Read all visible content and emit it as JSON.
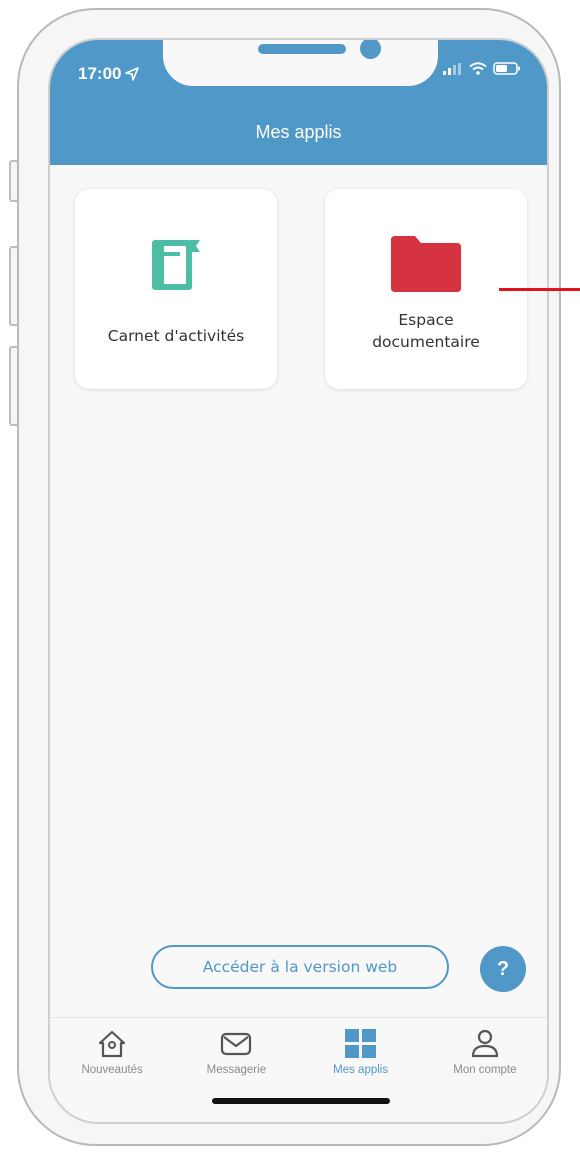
{
  "status_bar": {
    "time": "17:00",
    "icons": [
      "location-arrow-icon",
      "signal-icon",
      "wifi-icon",
      "battery-icon"
    ]
  },
  "header": {
    "title": "Mes applis"
  },
  "apps": [
    {
      "label": "Carnet d'activités",
      "icon": "notebook-icon",
      "color": "#4dbda6"
    },
    {
      "label": "Espace documentaire",
      "icon": "folder-icon",
      "color": "#d4333f"
    }
  ],
  "actions": {
    "web_version_label": "Accéder à la version web",
    "help_label": "?"
  },
  "tabbar": {
    "items": [
      {
        "label": "Nouveautés",
        "icon": "home-icon",
        "active": false
      },
      {
        "label": "Messagerie",
        "icon": "mail-icon",
        "active": false
      },
      {
        "label": "Mes applis",
        "icon": "apps-grid-icon",
        "active": true
      },
      {
        "label": "Mon compte",
        "icon": "user-icon",
        "active": false
      }
    ]
  },
  "colors": {
    "primary": "#4f98c8",
    "annotation": "#e0131f"
  }
}
